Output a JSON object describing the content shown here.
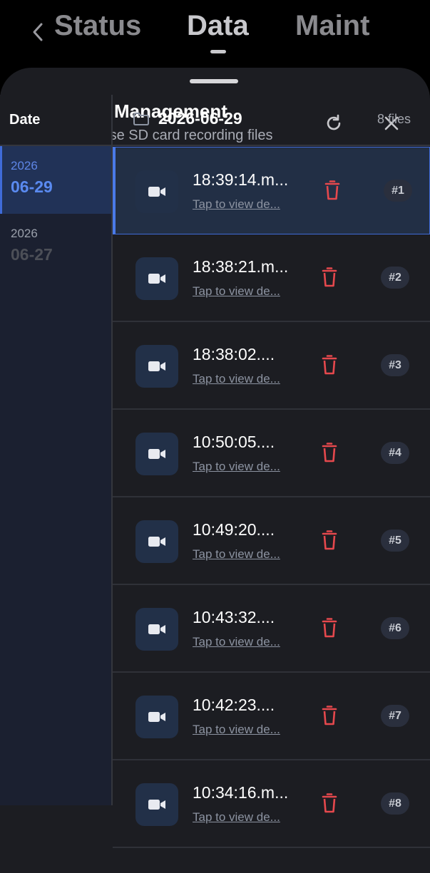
{
  "tabs": [
    {
      "label": "Status"
    },
    {
      "label": "Data"
    },
    {
      "label": "Maint"
    }
  ],
  "active_tab": "Data",
  "sheet": {
    "title": "File Management",
    "subtitle": "Browse SD card recording files"
  },
  "sidebar": {
    "header": "Date",
    "dates": [
      {
        "year": "2026",
        "day": "06-29",
        "active": true
      },
      {
        "year": "2026",
        "day": "06-27",
        "active": false
      }
    ]
  },
  "folder": {
    "name": "2026-06-29",
    "count": "8 files"
  },
  "files": [
    {
      "name": "18:39:14.m...",
      "hint": "Tap to view de...",
      "index": "#1"
    },
    {
      "name": "18:38:21.m...",
      "hint": "Tap to view de...",
      "index": "#2"
    },
    {
      "name": "18:38:02....",
      "hint": "Tap to view de...",
      "index": "#3"
    },
    {
      "name": "10:50:05....",
      "hint": "Tap to view de...",
      "index": "#4"
    },
    {
      "name": "10:49:20....",
      "hint": "Tap to view de...",
      "index": "#5"
    },
    {
      "name": "10:43:32....",
      "hint": "Tap to view de...",
      "index": "#6"
    },
    {
      "name": "10:42:23....",
      "hint": "Tap to view de...",
      "index": "#7"
    },
    {
      "name": "10:34:16.m...",
      "hint": "Tap to view de...",
      "index": "#8"
    }
  ],
  "icons": {
    "back": "chevron-left-icon",
    "header": "folder-icon",
    "refresh": "refresh-icon",
    "close": "close-icon",
    "file": "video-camera-icon",
    "delete": "trash-icon"
  },
  "colors": {
    "accent": "#4a7ae8",
    "delete": "#e5484d",
    "sheet_bg": "#1c1d22",
    "sidebar_bg": "#1b2030"
  }
}
